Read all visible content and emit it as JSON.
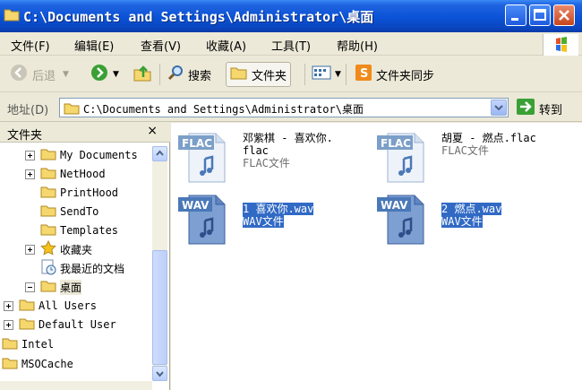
{
  "window": {
    "title": "C:\\Documents and Settings\\Administrator\\桌面"
  },
  "menu": [
    "文件(F)",
    "编辑(E)",
    "查看(V)",
    "收藏(A)",
    "工具(T)",
    "帮助(H)"
  ],
  "toolbar": {
    "back": "后退",
    "search": "搜索",
    "folders": "文件夹",
    "sync": "文件夹同步"
  },
  "address": {
    "label": "地址(D)",
    "path": "C:\\Documents and Settings\\Administrator\\桌面",
    "go": "转到"
  },
  "left_pane": {
    "title": "文件夹",
    "close": "×",
    "items": [
      {
        "label": "My Documents"
      },
      {
        "label": "NetHood"
      },
      {
        "label": "PrintHood"
      },
      {
        "label": "SendTo"
      },
      {
        "label": "Templates"
      },
      {
        "label": "收藏夹"
      },
      {
        "label": "我最近的文档"
      },
      {
        "label": "桌面"
      },
      {
        "label": "All Users"
      },
      {
        "label": "Default User"
      },
      {
        "label": "Intel"
      },
      {
        "label": "MSOCache"
      }
    ]
  },
  "files": [
    {
      "badge": "FLAC",
      "name1": "邓紫棋 - 喜欢你.",
      "name2": "flac",
      "type": "FLAC文件"
    },
    {
      "badge": "FLAC",
      "name1": "胡夏 - 燃点.flac",
      "name2": "",
      "type": "FLAC文件"
    },
    {
      "badge": "WAV",
      "name1": "1 喜欢你.wav",
      "name2": "",
      "type": "WAV文件"
    },
    {
      "badge": "WAV",
      "name1": "2 燃点.wav",
      "name2": "",
      "type": "WAV文件"
    }
  ],
  "colors": {
    "titlebar": "#0a52d6",
    "selection": "#316ac5",
    "flac_badge": "#7b9fc8",
    "wav_badge": "#4a78b8"
  }
}
